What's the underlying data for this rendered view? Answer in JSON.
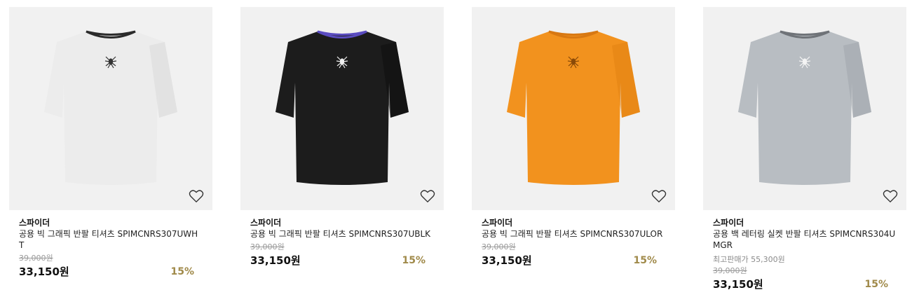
{
  "products": [
    {
      "brand": "스파이더",
      "name": "공용 빅 그래픽 반팔 티셔츠 SPIMCNRS307UWHT",
      "extra": "",
      "original_price": "39,000원",
      "price": "33,150원",
      "discount": "15%",
      "shirt_color": "#ececec",
      "shirt_shade": "#d8d8d8",
      "collar_color": "#2b2b2b"
    },
    {
      "brand": "스파이더",
      "name": "공용 빅 그래픽 반팔 티셔츠 SPIMCNRS307UBLK",
      "extra": "",
      "original_price": "39,000원",
      "price": "33,150원",
      "discount": "15%",
      "shirt_color": "#1c1c1c",
      "shirt_shade": "#0c0c0c",
      "collar_color": "#5a4cc0"
    },
    {
      "brand": "스파이더",
      "name": "공용 빅 그래픽 반팔 티셔츠 SPIMCNRS307ULOR",
      "extra": "",
      "original_price": "39,000원",
      "price": "33,150원",
      "discount": "15%",
      "shirt_color": "#f2921e",
      "shirt_shade": "#e07f10",
      "collar_color": "#d87812"
    },
    {
      "brand": "스파이더",
      "name": "공용 백 레터링 실켓 반팔 티셔츠 SPIMCNRS304UMGR",
      "extra": "최고판매가 55,300원",
      "original_price": "39,000원",
      "price": "33,150원",
      "discount": "15%",
      "shirt_color": "#b8bdc2",
      "shirt_shade": "#9ea4aa",
      "collar_color": "#6f7378"
    }
  ],
  "icons": {
    "wishlist": "heart-outline-icon",
    "logo": "spider-logo-icon"
  }
}
